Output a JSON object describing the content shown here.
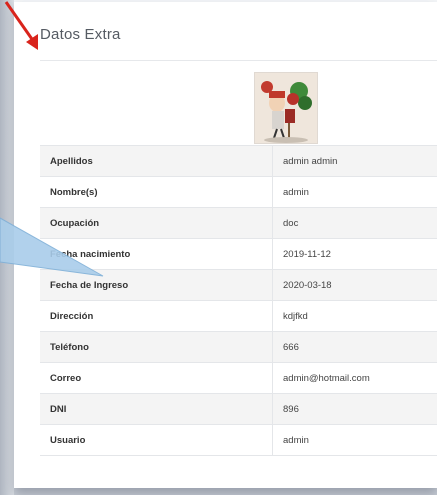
{
  "panel": {
    "title": "Datos Extra",
    "avatar_icon": "user-avatar-photo"
  },
  "details": [
    {
      "label": "Apellidos",
      "value": "admin admin"
    },
    {
      "label": "Nombre(s)",
      "value": "admin"
    },
    {
      "label": "Ocupación",
      "value": "doc"
    },
    {
      "label": "Fecha nacimiento",
      "value": "2019-11-12"
    },
    {
      "label": "Fecha de Ingreso",
      "value": "2020-03-18"
    },
    {
      "label": "Dirección",
      "value": "kdjfkd"
    },
    {
      "label": "Teléfono",
      "value": "666"
    },
    {
      "label": "Correo",
      "value": "admin@hotmail.com"
    },
    {
      "label": "DNI",
      "value": "896"
    },
    {
      "label": "Usuario",
      "value": "admin"
    }
  ],
  "annotations": {
    "arrow_color": "#d9241c",
    "callout_color": "#a9cdea"
  }
}
